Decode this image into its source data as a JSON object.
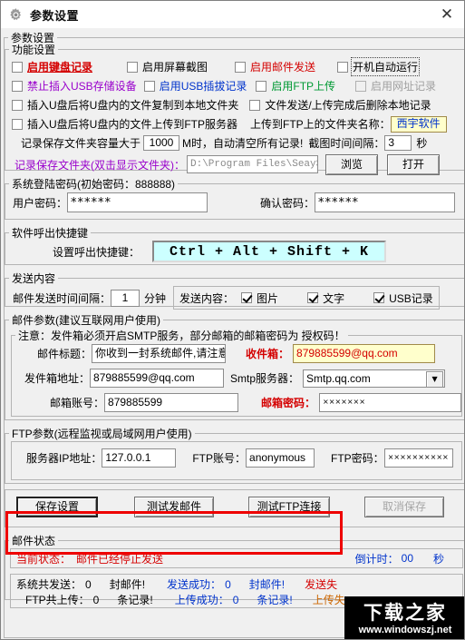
{
  "window": {
    "title": "参数设置",
    "icon": "gear-icon",
    "close_label": "✕"
  },
  "groups": {
    "params": "参数设置",
    "function": "功能设置",
    "login": "系统登陆密码(初始密码：888888)",
    "hotkey": "软件呼出快捷键",
    "send_content": "发送内容",
    "mail_params": "邮件参数(建议互联网用户使用)",
    "mail_notice": "注意：发件箱必须开启SMTP服务，部分邮箱的邮箱密码为 授权码！",
    "ftp_params": "FTP参数(远程监视或局域网用户使用)",
    "mail_status": "邮件状态"
  },
  "function": {
    "row1": [
      {
        "label": "启用键盘记录",
        "checked": false,
        "style": "redb",
        "disabled": false
      },
      {
        "label": "启用屏幕截图",
        "checked": false,
        "style": "black",
        "disabled": false
      },
      {
        "label": "启用邮件发送",
        "checked": false,
        "style": "red",
        "disabled": false
      },
      {
        "label": "开机自动运行",
        "checked": false,
        "style": "black",
        "disabled": false
      }
    ],
    "row2": [
      {
        "label": "禁止插入USB存储设备",
        "checked": false,
        "style": "purple",
        "disabled": false
      },
      {
        "label": "启用USB插拔记录",
        "checked": false,
        "style": "blue",
        "disabled": false
      },
      {
        "label": "启用FTP上传",
        "checked": false,
        "style": "green",
        "disabled": false
      },
      {
        "label": "启用网址记录",
        "checked": false,
        "style": "gray",
        "disabled": true
      }
    ],
    "row3": [
      {
        "label": "插入U盘后将U盘内的文件复制到本地文件夹",
        "checked": false
      },
      {
        "label": "文件发送/上传完成后删除本地记录",
        "checked": false
      }
    ],
    "row4": [
      {
        "label": "插入U盘后将U盘内的文件上传到FTP服务器",
        "checked": false
      }
    ],
    "ftp_folder_label": "上传到FTP上的文件夹名称：",
    "ftp_folder_value": "西宇软件",
    "capacity_prefix": "记录保存文件夹容量大于",
    "capacity_value": "1000",
    "capacity_suffix": "M时，自动清空所有记录!",
    "shot_interval_label": "截图时间间隔：",
    "shot_interval_value": "3",
    "shot_interval_unit": "秒",
    "folder_label": "记录保存文件夹(双击显示文件夹)：",
    "folder_value": "D:\\Program Files\\SeayS",
    "browse_btn": "浏览",
    "open_btn": "打开"
  },
  "login": {
    "user_password_label": "用户密码：",
    "user_password_value": "******",
    "confirm_password_label": "确认密码：",
    "confirm_password_value": "******"
  },
  "hotkey": {
    "label": "设置呼出快捷键：",
    "value": "Ctrl + Alt + Shift + K"
  },
  "send_content": {
    "interval_label": "邮件发送时间间隔：",
    "interval_value": "1",
    "interval_unit": "分钟",
    "content_label": "发送内容：",
    "options": [
      {
        "label": "图片",
        "checked": true
      },
      {
        "label": "文字",
        "checked": true
      },
      {
        "label": "USB记录",
        "checked": true
      }
    ]
  },
  "mail": {
    "title_label": "邮件标题：",
    "title_value": "你收到一封系统邮件,请注意",
    "to_label": "收件箱：",
    "to_value": "879885599@qq.com",
    "from_label": "发件箱地址：",
    "from_value": "879885599@qq.com",
    "smtp_label": "Smtp服务器：",
    "smtp_value": "Smtp.qq.com",
    "account_label": "邮箱账号：",
    "account_value": "879885599",
    "password_label": "邮箱密码：",
    "password_value": "×××××××"
  },
  "ftp": {
    "ip_label": "服务器IP地址：",
    "ip_value": "127.0.0.1",
    "account_label": "FTP账号：",
    "account_value": "anonymous",
    "password_label": "FTP密码：",
    "password_value": "××××××××××"
  },
  "buttons": {
    "save": "保存设置",
    "test_mail": "测试发邮件",
    "test_ftp": "测试FTP连接",
    "cancel": "取消保存"
  },
  "status": {
    "current_label": "当前状态：",
    "current_value": "邮件已经停止发送",
    "countdown_label": "倒计时：",
    "countdown_value": "00",
    "countdown_unit": "秒"
  },
  "stats": {
    "row1": {
      "sent_label": "系统共发送：",
      "sent_value": "0",
      "sent_unit": "封邮件!",
      "success_label": "发送成功：",
      "success_value": "0",
      "success_unit": "封邮件!",
      "fail_label": "发送失"
    },
    "row2": {
      "sent_label": "FTP共上传：",
      "sent_value": "0",
      "sent_unit": "条记录!",
      "success_label": "上传成功：",
      "success_value": "0",
      "success_unit": "条记录!",
      "fail_label": "上传失"
    }
  },
  "watermark": {
    "cn": "下载之家",
    "url": "www.windowszj.net"
  },
  "colors": {
    "red": "#d40000",
    "blue": "#0033cc",
    "green": "#009933",
    "purple": "#9900cc",
    "annot": "#ee0000",
    "yellow_bg": "#ffffcc",
    "cyan_bg": "#ccffff"
  }
}
